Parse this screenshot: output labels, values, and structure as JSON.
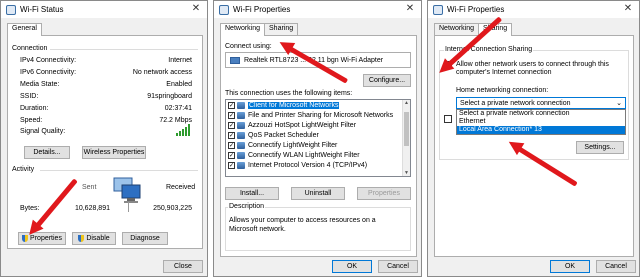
{
  "status_window": {
    "title": "Wi-Fi Status",
    "close_glyph": "✕",
    "tab": "General",
    "connection_heading": "Connection",
    "rows": [
      {
        "label": "IPv4 Connectivity:",
        "value": "Internet"
      },
      {
        "label": "IPv6 Connectivity:",
        "value": "No network access"
      },
      {
        "label": "Media State:",
        "value": "Enabled"
      },
      {
        "label": "SSID:",
        "value": "91springboard"
      },
      {
        "label": "Duration:",
        "value": "02:37:41"
      },
      {
        "label": "Speed:",
        "value": "72.2 Mbps"
      }
    ],
    "signal_label": "Signal Quality:",
    "signal_bars": 5,
    "details_btn": "Details...",
    "wireless_btn": "Wireless Properties",
    "activity_heading": "Activity",
    "sent_label": "Sent",
    "received_label": "Received",
    "bytes_label": "Bytes:",
    "bytes_sent": "10,628,891",
    "bytes_received": "250,903,225",
    "properties_btn": "Properties",
    "disable_btn": "Disable",
    "diagnose_btn": "Diagnose",
    "close_btn": "Close"
  },
  "props_window": {
    "title": "Wi-Fi Properties",
    "close_glyph": "✕",
    "tab_networking": "Networking",
    "tab_sharing": "Sharing",
    "connect_using_label": "Connect using:",
    "adapter": "Realtek RTL8723 ... 02.11 bgn Wi-Fi Adapter",
    "configure_btn": "Configure...",
    "items_label": "This connection uses the following items:",
    "items": [
      "Client for Microsoft Networks",
      "File and Printer Sharing for Microsoft Networks",
      "Azzouzi HotSpot LightWeight Filter",
      "QoS Packet Scheduler",
      "Connectify LightWeight Filter",
      "Connectify WLAN LightWeight Filter",
      "Internet Protocol Version 4 (TCP/IPv4)"
    ],
    "install_btn": "Install...",
    "uninstall_btn": "Uninstall",
    "properties_btn": "Properties",
    "description_heading": "Description",
    "description_text": "Allows your computer to access resources on a Microsoft network.",
    "ok_btn": "OK",
    "cancel_btn": "Cancel"
  },
  "sharing_window": {
    "title": "Wi-Fi Properties",
    "close_glyph": "✕",
    "tab_networking": "Networking",
    "tab_sharing": "Sharing",
    "ics_heading": "Internet Connection Sharing",
    "allow_text_1": "Allow other network users to connect through this",
    "allow_text_2": "computer's Internet connection",
    "home_label": "Home networking connection:",
    "select_value": "Select a private network connection",
    "dropdown_options": [
      "Select a private network connection",
      "Ethernet",
      "Local Area Connection* 13"
    ],
    "settings_btn": "Settings...",
    "ok_btn": "OK",
    "cancel_btn": "Cancel"
  },
  "colors": {
    "arrow": "#e0181c",
    "selection": "#0078d7",
    "signal": "#2e9b2e"
  }
}
